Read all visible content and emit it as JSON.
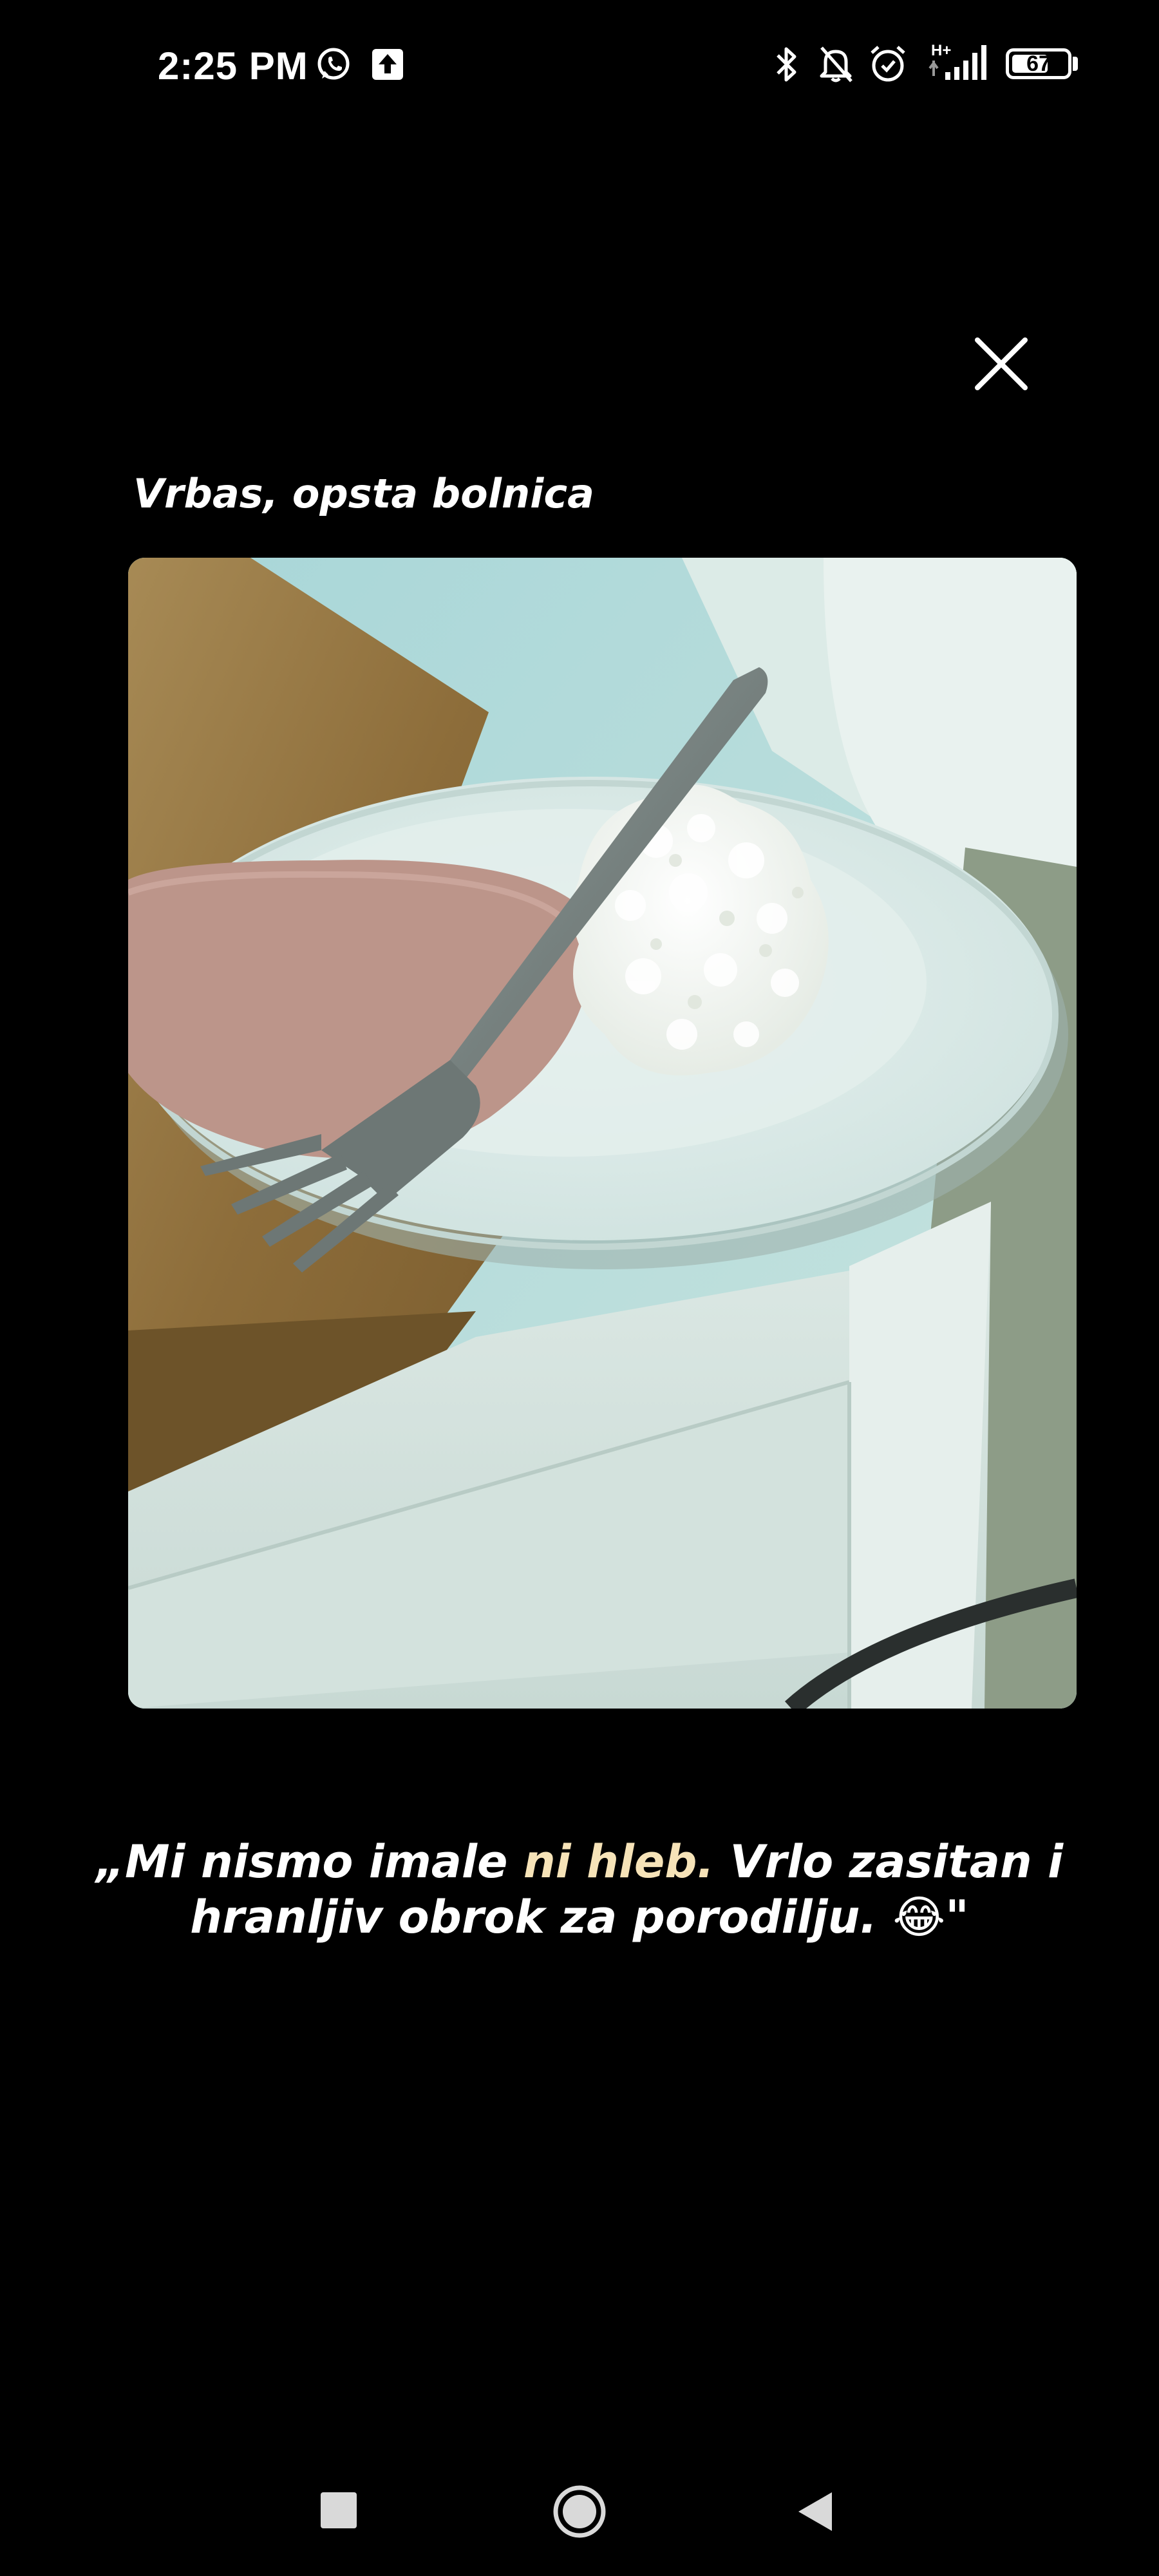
{
  "status_bar": {
    "time": "2:25 PM",
    "network_label": "H+",
    "battery_level": "67",
    "icons": [
      "whatsapp-icon",
      "upload-icon",
      "bluetooth-icon",
      "mute-bell-icon",
      "alarm-icon",
      "signal-icon",
      "battery-icon"
    ]
  },
  "viewer": {
    "title": "Vrbas, opsta bolnica",
    "close_icon": "close-icon",
    "caption": {
      "before": "„Mi nismo imale ",
      "highlight": "ni hleb.",
      "after": " Vrlo zasitan i hranljiv obrok za porodilju. 😂\""
    },
    "highlight_color": "#f6e3b8"
  },
  "nav_bar": {
    "icons": [
      "recent-apps-icon",
      "home-icon",
      "back-icon"
    ]
  }
}
